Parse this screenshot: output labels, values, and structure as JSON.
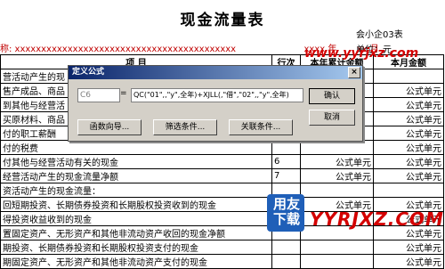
{
  "report": {
    "title": "现金流量表",
    "form_code": "会小企03表",
    "org_label": "称: xxxxxxxxxxxxxxxxxxxxxxxxxxxxxxxxxxxxxxxxxx",
    "year_label": "xxxx  年",
    "month_label": "xx  月",
    "unit_label": "单位：元"
  },
  "table": {
    "headers": [
      "项        目",
      "行次",
      "本年累计金额",
      "本月金额"
    ],
    "rows": [
      [
        "营活动产生的现",
        "",
        "",
        ""
      ],
      [
        "售产成品、商品",
        "",
        "",
        "公式单元"
      ],
      [
        "到其他与经营活",
        "",
        "",
        "公式单元"
      ],
      [
        "买原材料、商品",
        "",
        "",
        "公式单元"
      ],
      [
        "付的职工薪酬",
        "",
        "",
        "公式单元"
      ],
      [
        "付的税费",
        "",
        "",
        "公式单元"
      ],
      [
        "付其他与经营活动有关的现金",
        "6",
        "公式单元",
        "公式单元"
      ],
      [
        "经营活动产生的现金流量净额",
        "7",
        "公式单元",
        "公式单元"
      ],
      [
        "资活动产生的现金流量：",
        "",
        "",
        ""
      ],
      [
        "回短期投资、长期债券投资和长期股权投资收到的现金",
        "8",
        "公式单元",
        "公式单元"
      ],
      [
        "得投资收益收到的现金",
        "",
        "",
        "公式单元"
      ],
      [
        "置固定资产、无形资产和其他非流动资产收回的现金净额",
        "",
        "",
        "公式单元"
      ],
      [
        "期投资、长期债券投资和长期股权投资支付的现金",
        "",
        "",
        "公式单元"
      ],
      [
        "期固定资产、无形资产和其他非流动资产支付的现金",
        "",
        "",
        "公式单元"
      ]
    ]
  },
  "watermark": "www.yyrjxz.com",
  "dialog": {
    "title": "定义公式",
    "close_glyph": "×",
    "cell_ref": "C6",
    "equals": "=",
    "formula": "QC(\"01\",,\"y\",全年)+XJLL(,\"借\",\"02\",,\"y\",全年)",
    "buttons": {
      "ok": "确认",
      "cancel": "取消",
      "wizard": "函数向导...",
      "filter": "筛选条件...",
      "relation": "关联条件..."
    }
  },
  "logo": {
    "line1": "用友",
    "line2": "下载",
    "brand": "YYRJXZ.COM"
  }
}
